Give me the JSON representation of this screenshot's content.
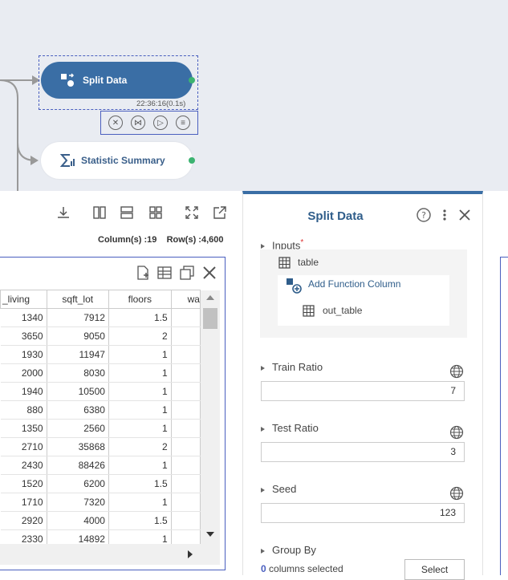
{
  "canvas": {
    "split_node": {
      "label": "Split Data",
      "time": "22:36:16(0.1s)"
    },
    "stat_node": {
      "label": "Statistic Summary"
    }
  },
  "toolbar": {
    "columns_text": "Column(s) :19",
    "rows_text": "Row(s) :4,600"
  },
  "table": {
    "columns": [
      "_living",
      "sqft_lot",
      "floors",
      "wa"
    ],
    "rows": [
      [
        "1340",
        "7912",
        "1.5",
        ""
      ],
      [
        "3650",
        "9050",
        "2",
        ""
      ],
      [
        "1930",
        "11947",
        "1",
        ""
      ],
      [
        "2000",
        "8030",
        "1",
        ""
      ],
      [
        "1940",
        "10500",
        "1",
        ""
      ],
      [
        "880",
        "6380",
        "1",
        ""
      ],
      [
        "1350",
        "2560",
        "1",
        ""
      ],
      [
        "2710",
        "35868",
        "2",
        ""
      ],
      [
        "2430",
        "88426",
        "1",
        ""
      ],
      [
        "1520",
        "6200",
        "1.5",
        ""
      ],
      [
        "1710",
        "7320",
        "1",
        ""
      ],
      [
        "2920",
        "4000",
        "1.5",
        ""
      ],
      [
        "2330",
        "14892",
        "1",
        ""
      ]
    ]
  },
  "props": {
    "title": "Split Data",
    "inputs_label": "Inputs",
    "required_mark": "*",
    "input_table": "table",
    "add_function_column": "Add Function Column",
    "output_table": "out_table",
    "train_ratio_label": "Train Ratio",
    "train_ratio_value": "7",
    "test_ratio_label": "Test Ratio",
    "test_ratio_value": "3",
    "seed_label": "Seed",
    "seed_value": "123",
    "group_by_label": "Group By",
    "selected_count": "0",
    "selected_suffix": " columns selected",
    "select_button": "Select"
  },
  "colors": {
    "accent": "#3a6ea5",
    "selection": "#4a5fbf",
    "port": "#3cb371"
  }
}
